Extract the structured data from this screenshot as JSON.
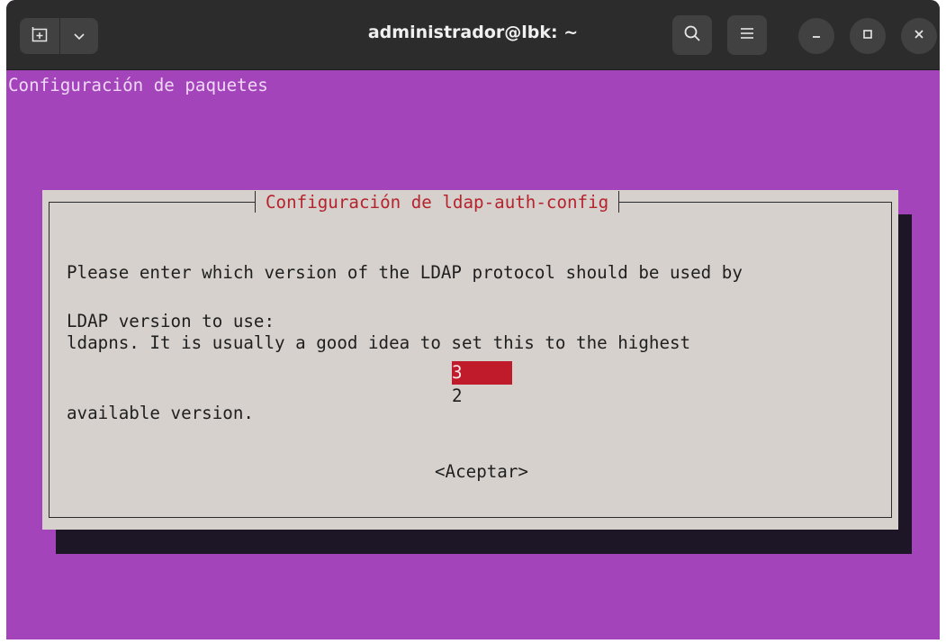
{
  "window": {
    "title": "administrador@lbk: ~"
  },
  "titlebar_icons": {
    "new_tab": "new-tab-icon",
    "menu_dropdown": "chevron-down-icon",
    "search": "search-icon",
    "hamburger": "hamburger-menu-icon",
    "minimize": "minimize-icon",
    "maximize": "maximize-icon",
    "close": "close-icon"
  },
  "terminal": {
    "header": "Configuración de paquetes"
  },
  "dialog": {
    "title": "Configuración de ldap-auth-config",
    "description_lines": [
      "Please enter which version of the LDAP protocol should be used by",
      "ldapns. It is usually a good idea to set this to the highest",
      "available version."
    ],
    "prompt": "LDAP version to use:",
    "options": [
      {
        "label": "3",
        "selected": true
      },
      {
        "label": "2",
        "selected": false
      }
    ],
    "accept_label": "<Aceptar>"
  },
  "colors": {
    "terminal_bg": "#a344bb",
    "dialog_bg": "#d6d1cd",
    "dialog_title": "#b5232d",
    "selection_bg": "#c01b2b",
    "titlebar_bg": "#2c2c2c"
  }
}
